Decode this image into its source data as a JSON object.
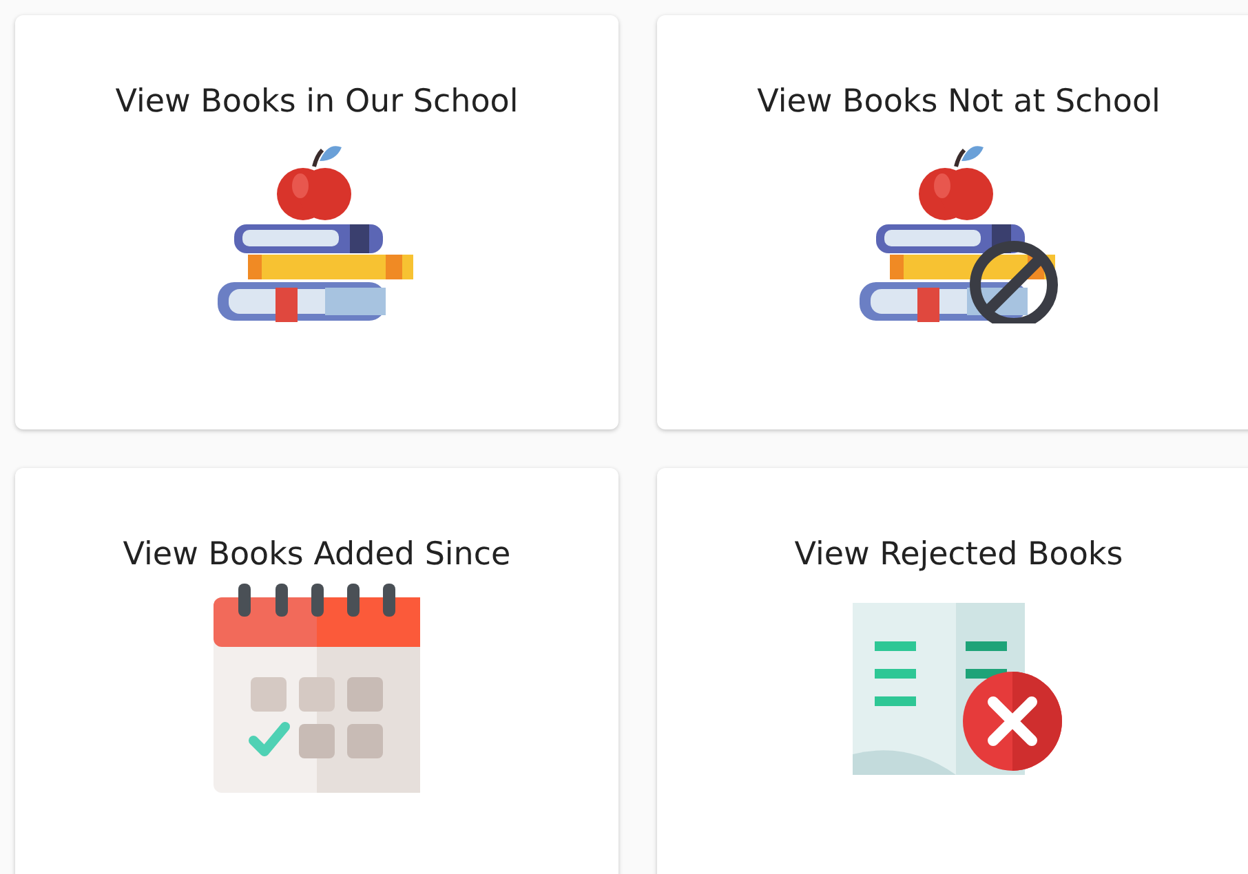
{
  "cards": [
    {
      "title": "View Books in Our School",
      "kind": "books"
    },
    {
      "title": "View Books Not at School",
      "kind": "blocked"
    },
    {
      "title": "View Books Added Since",
      "kind": "calendar"
    },
    {
      "title": "View Rejected Books",
      "kind": "rejected"
    }
  ]
}
